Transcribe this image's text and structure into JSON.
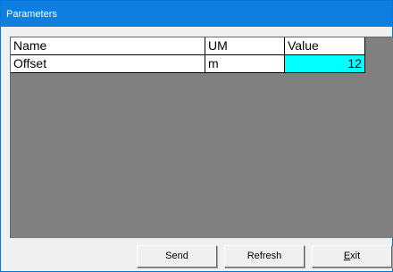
{
  "window": {
    "title": "Parameters"
  },
  "table": {
    "columns": [
      "Name",
      "UM",
      "Value"
    ],
    "rows": [
      {
        "name": "Offset",
        "um": "m",
        "value": "12"
      }
    ]
  },
  "buttons": {
    "send": "Send",
    "refresh": "Refresh",
    "exit_mnemonic": "E",
    "exit_rest": "xit"
  },
  "colors": {
    "titlebar": "#0e7fe0",
    "grid_background": "#808080",
    "selected_cell": "#00ffff"
  }
}
